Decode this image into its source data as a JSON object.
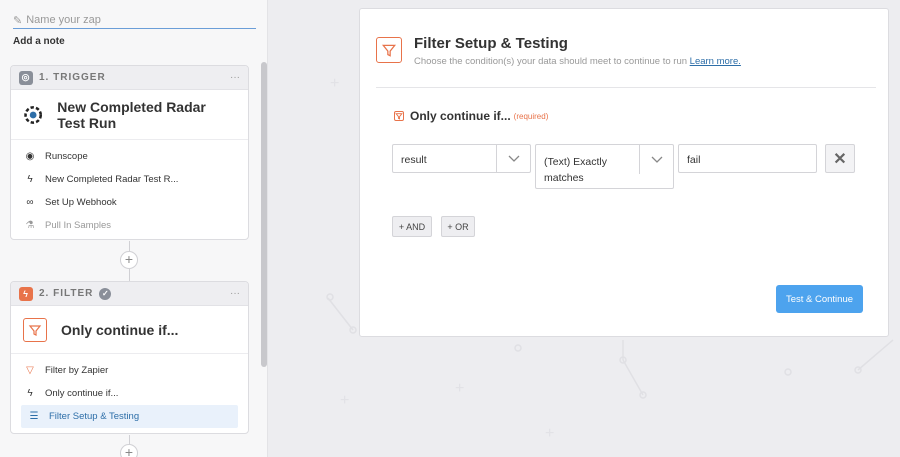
{
  "sidebar": {
    "zap_name_placeholder": "Name your zap",
    "add_note": "Add a note",
    "trigger": {
      "header": "1. TRIGGER",
      "menu": "···",
      "app_title": "New Completed Radar Test Run",
      "steps": [
        {
          "label": "Runscope",
          "icon": "runscope-icon"
        },
        {
          "label": "New Completed Radar Test R...",
          "icon": "bolt-icon"
        },
        {
          "label": "Set Up Webhook",
          "icon": "link-icon"
        },
        {
          "label": "Pull In Samples",
          "icon": "flask-icon"
        }
      ]
    },
    "filter": {
      "header": "2. FILTER",
      "menu": "···",
      "app_title": "Only continue if...",
      "steps": [
        {
          "label": "Filter by Zapier",
          "icon": "filter-icon"
        },
        {
          "label": "Only continue if...",
          "icon": "bolt-icon"
        },
        {
          "label": "Filter Setup & Testing",
          "icon": "list-icon"
        }
      ]
    },
    "plus": "+"
  },
  "main": {
    "title": "Filter Setup & Testing",
    "subtitle": "Choose the condition(s) your data should meet to continue to run",
    "learn_more": "Learn more.",
    "only_continue": "Only continue if...",
    "required": "(required)",
    "condition": {
      "field": "result",
      "operator_line1": "(Text) Exactly",
      "operator_line2": "matches",
      "value": "fail"
    },
    "and_label": "+ AND",
    "or_label": "+ OR",
    "test_continue": "Test & Continue"
  },
  "colors": {
    "accent": "#4da3ee",
    "filter_orange": "#e8734a",
    "trigger_gray": "#8a8f99"
  }
}
